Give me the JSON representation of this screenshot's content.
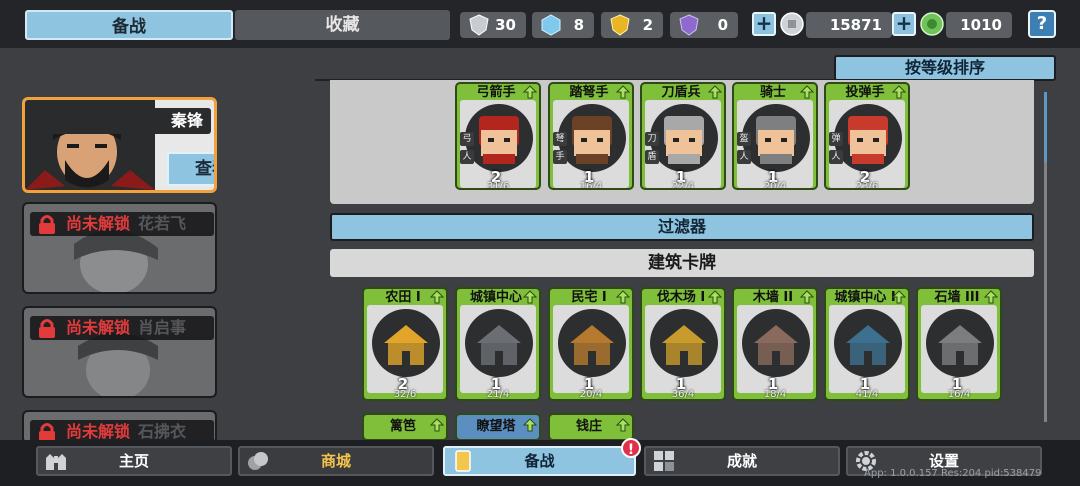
{
  "tabs": {
    "active": "备战",
    "inactive": "收藏"
  },
  "resources": [
    {
      "name": "silver-shield-icon",
      "value": "30",
      "color": "#c8ccd2"
    },
    {
      "name": "blue-crystal-icon",
      "value": "8",
      "color": "#7fc9ee"
    },
    {
      "name": "gold-shield-icon",
      "value": "2",
      "color": "#e8b623"
    },
    {
      "name": "purple-shield-icon",
      "value": "0",
      "color": "#8e6ad0"
    }
  ],
  "currency": {
    "silver": "15871",
    "green": "1010"
  },
  "help_label": "?",
  "sort_label": "按等级排序",
  "filter_label": "过滤器",
  "section_label": "建筑卡牌",
  "hero": {
    "name": "秦锋",
    "detail_label": "查看详情"
  },
  "locked_heroes": [
    {
      "lock": "尚未解锁",
      "name": "花若飞"
    },
    {
      "lock": "尚未解锁",
      "name": "肖启事"
    },
    {
      "lock": "尚未解锁",
      "name": "石拂衣"
    }
  ],
  "unit_cards": [
    {
      "title": "弓箭手",
      "count": "2",
      "progress": "31/6",
      "icons": [
        "弓",
        "人"
      ]
    },
    {
      "title": "踏弩手",
      "count": "1",
      "progress": "16/4",
      "icons": [
        "弩",
        "手"
      ]
    },
    {
      "title": "刀盾兵",
      "count": "1",
      "progress": "22/4",
      "icons": [
        "刀",
        "盾"
      ]
    },
    {
      "title": "骑士",
      "count": "1",
      "progress": "20/4",
      "icons": [
        "盔",
        "人"
      ]
    },
    {
      "title": "投弹手",
      "count": "2",
      "progress": "23/6",
      "icons": [
        "弹",
        "人"
      ]
    }
  ],
  "building_cards": [
    {
      "title": "农田 I",
      "count": "2",
      "progress": "32/6"
    },
    {
      "title": "城镇中心",
      "count": "1",
      "progress": "21/4"
    },
    {
      "title": "民宅 I",
      "count": "1",
      "progress": "20/4"
    },
    {
      "title": "伐木场 I",
      "count": "1",
      "progress": "36/4"
    },
    {
      "title": "木墙 II",
      "count": "1",
      "progress": "18/4"
    },
    {
      "title": "城镇中心 I",
      "count": "1",
      "progress": "41/4"
    },
    {
      "title": "石墙 III",
      "count": "1",
      "progress": "16/4"
    }
  ],
  "building_cards_row2": [
    {
      "title": "篱笆"
    },
    {
      "title": "瞭望塔"
    },
    {
      "title": "钱庄"
    }
  ],
  "nav": {
    "home": "主页",
    "shop": "商城",
    "prepare": "备战",
    "achievements": "成就",
    "settings": "设置",
    "alert": "!"
  },
  "version_text": "App: 1.0.0.157 Res:204 pid:538479",
  "colors": {
    "accent_blue": "#8fc4e0",
    "card_green": "#7fbf3a",
    "hero_border": "#f2a23c",
    "lock_red": "#e23b3b"
  }
}
